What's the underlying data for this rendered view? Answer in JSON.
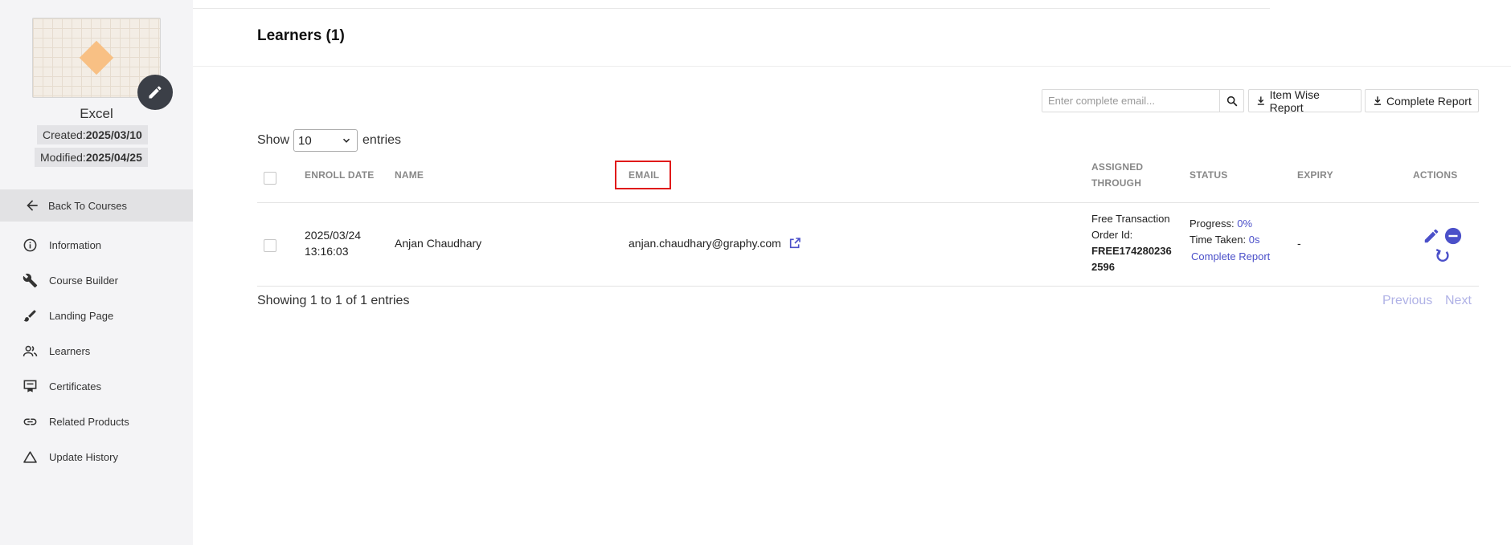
{
  "sidebar": {
    "course_name": "Excel",
    "created_label": "Created:",
    "created_value": "2025/03/10",
    "modified_label": "Modified:",
    "modified_value": "2025/04/25",
    "back_label": "Back To Courses",
    "items": [
      {
        "label": "Information",
        "icon": "info-icon"
      },
      {
        "label": "Course Builder",
        "icon": "wrench-icon"
      },
      {
        "label": "Landing Page",
        "icon": "brush-icon"
      },
      {
        "label": "Learners",
        "icon": "people-icon"
      },
      {
        "label": "Certificates",
        "icon": "certificate-icon"
      },
      {
        "label": "Related Products",
        "icon": "link-icon"
      },
      {
        "label": "Update History",
        "icon": "triangle-icon"
      }
    ]
  },
  "header": {
    "title": "Learners (1)"
  },
  "toolbar": {
    "search_placeholder": "Enter complete email...",
    "item_wise_report": "Item Wise Report",
    "complete_report": "Complete Report"
  },
  "entries": {
    "show_label": "Show",
    "page_size": "10",
    "entries_label": "entries"
  },
  "table": {
    "headers": {
      "enroll_date": "ENROLL DATE",
      "name": "NAME",
      "email": "EMAIL",
      "assigned_line1": "ASSIGNED",
      "assigned_line2": "THROUGH",
      "status": "STATUS",
      "expiry": "EXPIRY",
      "actions": "ACTIONS"
    },
    "rows": [
      {
        "enroll_date": "2025/03/24",
        "enroll_time": "13:16:03",
        "name": "Anjan Chaudhary",
        "email": "anjan.chaudhary@graphy.com",
        "assigned_line1": "Free Transaction",
        "assigned_line2": "Order Id:",
        "order_id_line1": "FREE174280236",
        "order_id_line2": "2596",
        "progress_label": "Progress:",
        "progress_value": "0%",
        "time_label": "Time Taken:",
        "time_value": "0s",
        "complete_report": "Complete Report",
        "expiry": "-"
      }
    ]
  },
  "footer": {
    "showing": "Showing 1 to 1 of 1 entries",
    "previous": "Previous",
    "next": "Next"
  },
  "colors": {
    "accent": "#4b50c9",
    "highlight": "#e01a1a",
    "sidebar_bg": "#f4f4f6"
  }
}
